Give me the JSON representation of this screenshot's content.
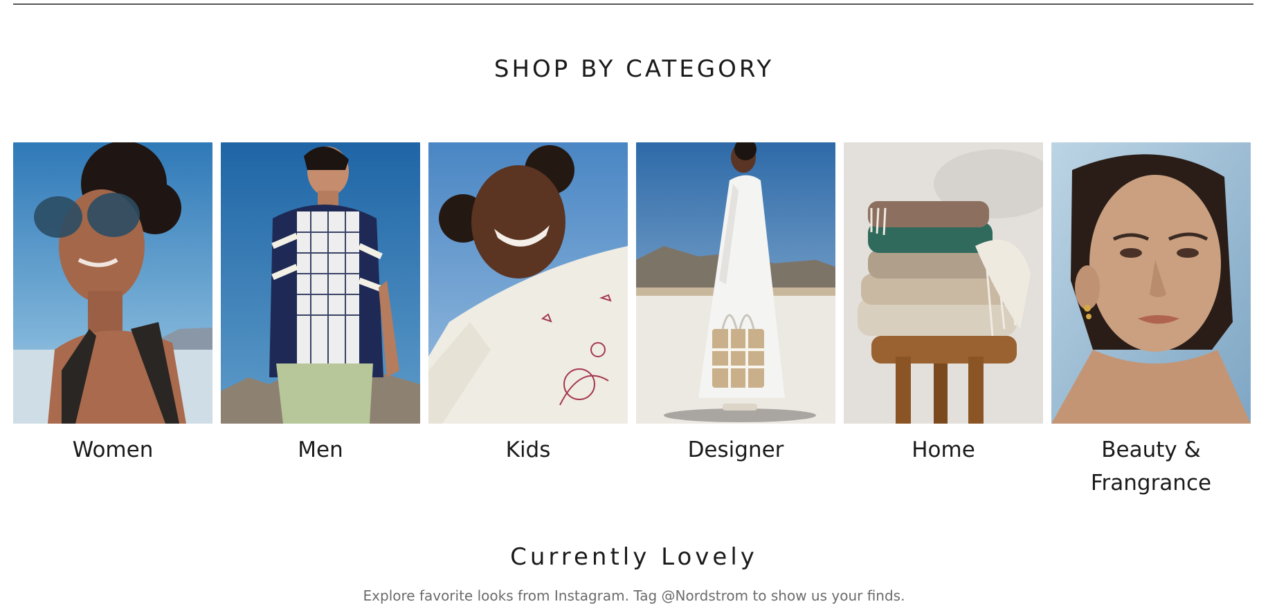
{
  "shop_by_category": {
    "title": "SHOP BY CATEGORY",
    "categories": [
      {
        "label": "Women",
        "image": "woman-sunglasses-photo"
      },
      {
        "label": "Men",
        "image": "man-striped-sweater-photo"
      },
      {
        "label": "Kids",
        "image": "smiling-child-photo"
      },
      {
        "label": "Designer",
        "image": "woman-white-dress-tote-photo"
      },
      {
        "label": "Home",
        "image": "stacked-blankets-stool-photo"
      },
      {
        "label": "Beauty & Frangrance",
        "image": "woman-face-beauty-photo"
      }
    ]
  },
  "currently_lovely": {
    "title": "Currently Lovely",
    "subtitle": "Explore favorite looks from Instagram. Tag @Nordstrom to show us your finds."
  }
}
